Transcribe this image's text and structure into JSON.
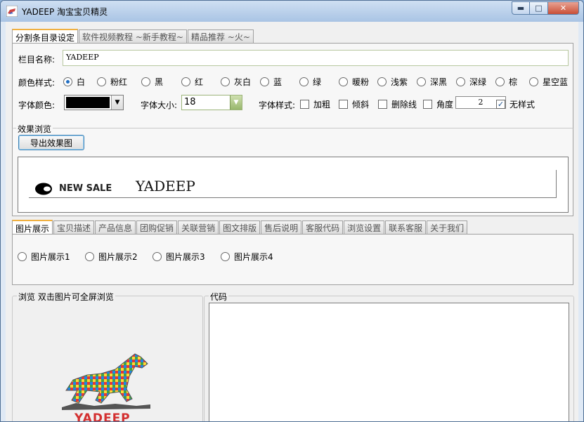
{
  "window": {
    "title": "YADEEP 淘宝宝贝精灵",
    "controls": {
      "minimize": "▬",
      "maximize": "□",
      "close": "✕"
    }
  },
  "top_tabs": [
    "分割条目录设定",
    "软件视频教程 ~新手教程~",
    "精品推荐 ~火~"
  ],
  "settings": {
    "column_name_label": "栏目名称:",
    "column_name_value": "YADEEP",
    "color_style_label": "颜色样式:",
    "color_options": [
      "白",
      "粉红",
      "黑",
      "红",
      "灰白",
      "蓝",
      "绿",
      "暖粉",
      "浅紫",
      "深黑",
      "深绿",
      "棕",
      "星空蓝"
    ],
    "selected_color": "白",
    "font_color_label": "字体颜色:",
    "font_color_value": "#000000",
    "font_size_label": "字体大小:",
    "font_size_value": "18",
    "font_style_label": "字体样式:",
    "style_options": [
      {
        "label": "加粗",
        "checked": false
      },
      {
        "label": "倾斜",
        "checked": false
      },
      {
        "label": "删除线",
        "checked": false
      },
      {
        "label": "角度",
        "checked": false
      }
    ],
    "angle_value": "2",
    "no_style": {
      "label": "无样式",
      "checked": true
    }
  },
  "preview": {
    "group_title": "效果浏览",
    "export_button": "导出效果图",
    "banner_badge": "NEW SALE",
    "banner_text": "YADEEP"
  },
  "bottom_tabs": [
    "图片展示",
    "宝贝描述",
    "产品信息",
    "团购促销",
    "关联营销",
    "图文排版",
    "售后说明",
    "客服代码",
    "浏览设置",
    "联系客服",
    "关于我们"
  ],
  "image_display": {
    "options": [
      "图片展示1",
      "图片展示2",
      "图片展示3",
      "图片展示4"
    ]
  },
  "browse": {
    "title": "浏览   双击图片可全屏浏览",
    "logo_text": "YADEEP"
  },
  "code": {
    "title": "代码"
  }
}
